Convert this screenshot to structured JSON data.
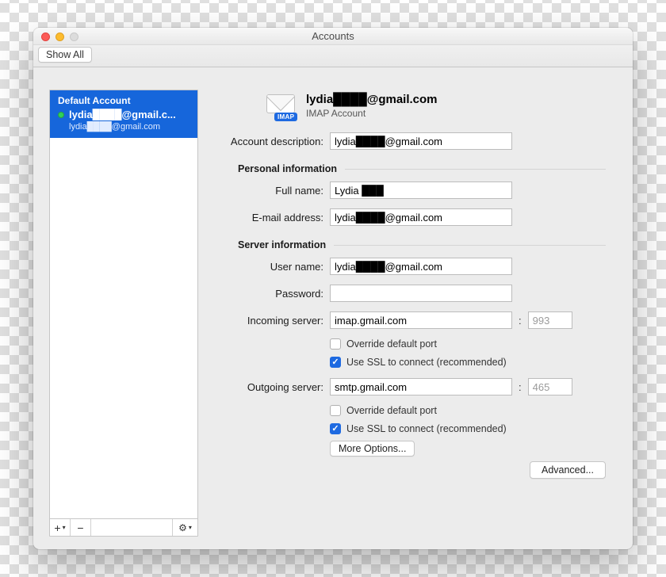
{
  "window": {
    "title": "Accounts",
    "show_all": "Show All"
  },
  "sidebar": {
    "default_label": "Default Account",
    "account_name": "lydia████@gmail.c...",
    "account_sub": "lydia████@gmail.com",
    "footer": {
      "add_label": "+",
      "remove_label": "−",
      "gear_label": "⚙",
      "gear_chevron": "▾"
    }
  },
  "header": {
    "title": "lydia████@gmail.com",
    "subtitle": "IMAP Account",
    "imap_badge": "IMAP"
  },
  "labels": {
    "account_description": "Account description:",
    "personal_info": "Personal information",
    "full_name": "Full name:",
    "email": "E-mail address:",
    "server_info": "Server information",
    "username": "User name:",
    "password": "Password:",
    "incoming": "Incoming server:",
    "outgoing": "Outgoing server:",
    "override_port": "Override default port",
    "use_ssl": "Use SSL to connect (recommended)",
    "more_options": "More Options...",
    "advanced": "Advanced..."
  },
  "values": {
    "account_description": "lydia████@gmail.com",
    "full_name": "Lydia ███",
    "email": "lydia████@gmail.com",
    "username": "lydia████@gmail.com",
    "password": "",
    "incoming_server": "imap.gmail.com",
    "incoming_port": "993",
    "outgoing_server": "smtp.gmail.com",
    "outgoing_port": "465"
  },
  "checkboxes": {
    "incoming_override": false,
    "incoming_ssl": true,
    "outgoing_override": false,
    "outgoing_ssl": true
  }
}
